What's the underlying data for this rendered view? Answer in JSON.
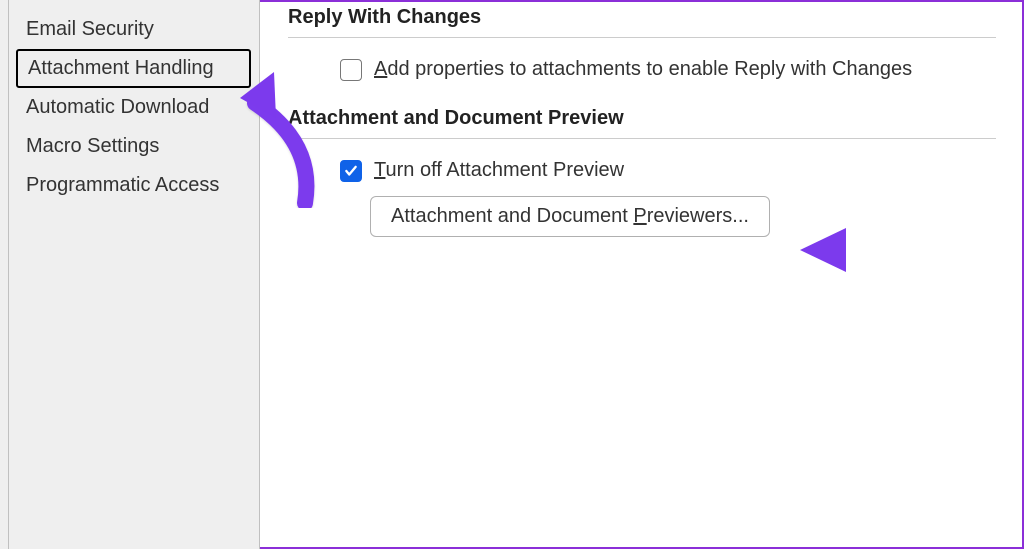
{
  "sidebar": {
    "items": [
      {
        "label": "Email Security"
      },
      {
        "label": "Attachment Handling"
      },
      {
        "label": "Automatic Download"
      },
      {
        "label": "Macro Settings"
      },
      {
        "label": "Programmatic Access"
      }
    ],
    "selected_index": 1
  },
  "sections": {
    "reply": {
      "title": "Reply With Changes",
      "option": {
        "prefix": "A",
        "rest": "dd properties to attachments to enable Reply with Changes",
        "checked": false
      }
    },
    "preview": {
      "title": "Attachment and Document Preview",
      "turn_off": {
        "prefix": "T",
        "rest": "urn off Attachment Preview",
        "checked": true
      },
      "button": {
        "before": "Attachment and Document ",
        "ul": "P",
        "after": "reviewers..."
      }
    }
  },
  "colors": {
    "accent_purple": "#7c3aed",
    "checkbox_blue": "#0f62e8"
  }
}
